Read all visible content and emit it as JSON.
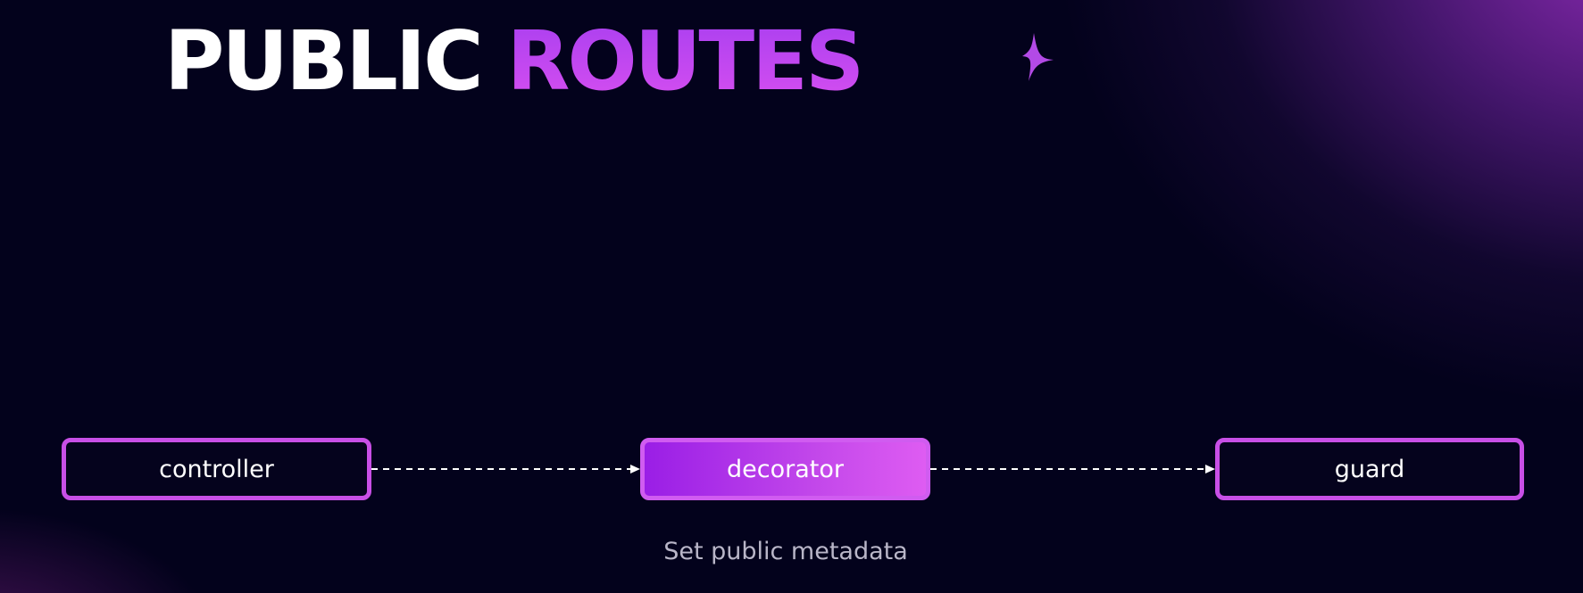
{
  "title": {
    "word1": "PUBLIC",
    "word2": "ROUTES"
  },
  "colors": {
    "background": "#03021c",
    "accent": "#c84fe6",
    "accent_fill": "#9a1ee6",
    "caption": "#b9b6c8"
  },
  "icons": {
    "sparkle": "four-point-star-icon"
  },
  "diagram": {
    "nodes": [
      {
        "id": "controller",
        "label": "controller",
        "highlighted": false
      },
      {
        "id": "decorator",
        "label": "decorator",
        "highlighted": true
      },
      {
        "id": "guard",
        "label": "guard",
        "highlighted": false
      }
    ],
    "edges": [
      {
        "from": "controller",
        "to": "decorator",
        "style": "dashed"
      },
      {
        "from": "decorator",
        "to": "guard",
        "style": "dashed"
      }
    ],
    "caption": "Set public metadata"
  }
}
